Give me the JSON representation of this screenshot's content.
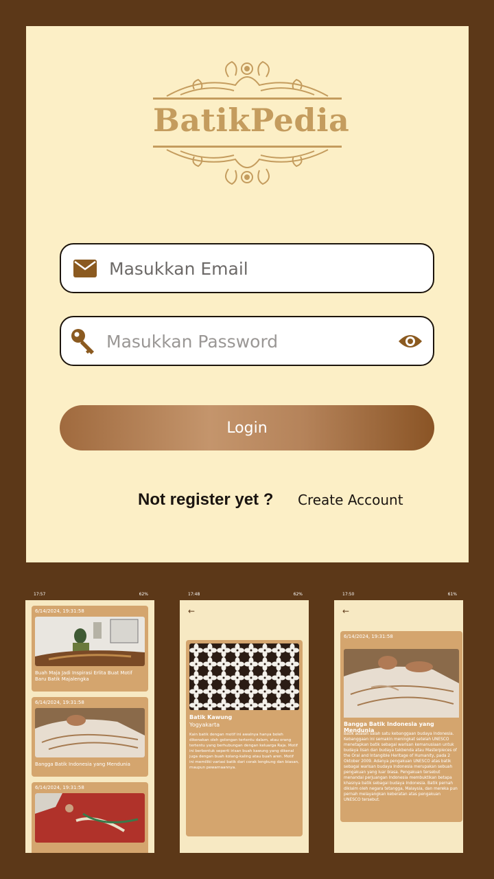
{
  "app": {
    "name": "BatikPedia"
  },
  "login": {
    "email_placeholder": "Masukkan Email",
    "email_value": "",
    "password_placeholder": "Masukkan Password",
    "password_value": "",
    "login_label": "Login",
    "not_registered": "Not register yet ?",
    "create_account": "Create Account"
  },
  "icons": {
    "email": "envelope-icon",
    "password": "key-icon",
    "show_password": "eye-icon",
    "back": "arrow-left-icon"
  },
  "colors": {
    "background": "#5c3818",
    "panel": "#fcefc6",
    "logo": "#c49c5e",
    "card": "#d4a56e",
    "button_dark": "#8a5425",
    "button_light": "#c4956c"
  },
  "phone1": {
    "status_time": "17:57",
    "status_right": "62%",
    "cards": [
      {
        "date": "6/14/2024, 19:31:58",
        "title": "Buah Maja Jadi Inspirasi Erlita Buat Motif Baru Batik Majalengka"
      },
      {
        "date": "6/14/2024, 19:31:58",
        "title": "Bangga Batik Indonesia yang Mendunia"
      },
      {
        "date": "6/14/2024, 19:31:58",
        "title": ""
      }
    ]
  },
  "phone2": {
    "status_time": "17:48",
    "status_right": "62%",
    "batik_name": "Batik Kawung",
    "batik_origin": "Yogyakarta",
    "batik_desc": "Kain batik dengan motif ini awalnya hanya boleh dikenakan oleh golongan tertentu dalam, atau orang tertentu yang berhubungan dengan keluarga Raja. Motif ini berbentuk seperti irisan buah kawung yang dikenal juga dengan buah kolang-kaling atau buah aren. Motif ini memiliki variasi batik dari corak lengkung dan biasan, maupun pewarnaannya."
  },
  "phone3": {
    "status_time": "17:50",
    "status_right": "61%",
    "date": "6/14/2024, 19:31:58",
    "headline": "Bangga Batik Indonesia yang Mendunia",
    "body": "Batik adalah salah satu kebanggaan budaya Indonesia. Kebanggaan ini semakin meningkat setelah UNESCO menetapkan batik sebagai warisan kemanusiaan untuk budaya lisan dan budaya takbenda atau Masterpieces of the Oral and Intangible Heritage of Humanity, pada 2 Oktober 2009. Adanya pengakuan UNESCO atas batik sebagai warisan budaya Indonesia merupakan sebuah pengakuan yang luar biasa. Pengakuan tersebut menandai perjuangan Indonesia membuktikan betapa khasnya batik sebagai budaya Indonesia. Batik pernah diklaim oleh negara tetangga, Malaysia, dan mereka pun pernah melayangkan keberatan atas pengakuan UNESCO tersebut."
  }
}
